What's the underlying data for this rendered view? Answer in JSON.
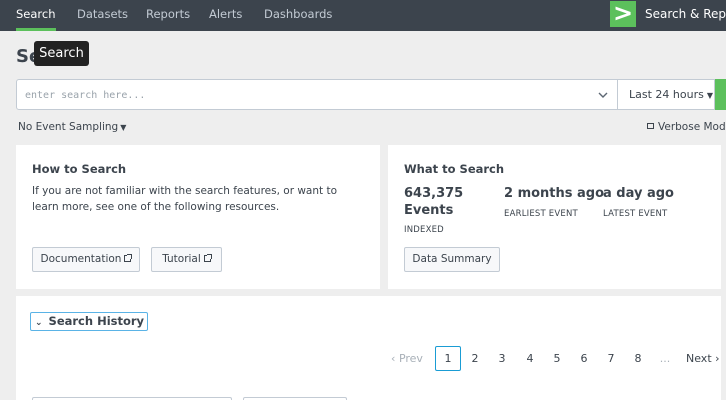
{
  "nav": {
    "items": [
      {
        "label": "Search",
        "active": true
      },
      {
        "label": "Datasets"
      },
      {
        "label": "Reports"
      },
      {
        "label": "Alerts"
      },
      {
        "label": "Dashboards"
      }
    ],
    "app_name": "Search & Reporting",
    "app_logo_glyph": ">"
  },
  "page": {
    "title": "Search",
    "tooltip": "Search"
  },
  "search": {
    "placeholder": "enter search here...",
    "value": "",
    "time_range": "Last 24 hours"
  },
  "options": {
    "sampling": "No Event Sampling",
    "mode": "Verbose Mode"
  },
  "how_to_search": {
    "title": "How to Search",
    "description": "If you are not familiar with the search features, or want to learn more, see one of the following resources.",
    "buttons": [
      "Documentation",
      "Tutorial"
    ]
  },
  "what_to_search": {
    "title": "What to Search",
    "events_value": "643,375",
    "events_unit": "Events",
    "events_label": "INDEXED",
    "earliest_value": "2 months ago",
    "earliest_label": "EARLIEST EVENT",
    "latest_value": "a day ago",
    "latest_label": "LATEST EVENT",
    "button": "Data Summary"
  },
  "search_history": {
    "title": "Search History",
    "pagination": {
      "prev": "‹ Prev",
      "pages": [
        "1",
        "2",
        "3",
        "4",
        "5",
        "6",
        "7",
        "8"
      ],
      "current": "1",
      "ellipsis": "...",
      "next": "Next ›"
    }
  },
  "colors": {
    "topbar": "#3c444d",
    "accent_green": "#5cc05c",
    "focus_blue": "#1a9cd4"
  }
}
